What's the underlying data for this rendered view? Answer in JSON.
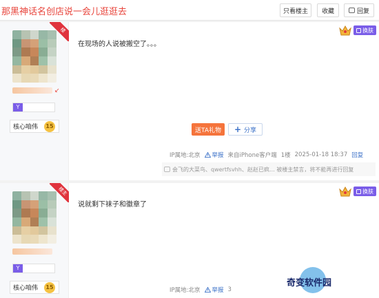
{
  "header": {
    "title": "那黑神话名创店说一会儿逛逛去",
    "only_host": "只看楼主",
    "favorite": "收藏",
    "reply": "回复"
  },
  "posts": [
    {
      "ribbon": "楼",
      "text": "在现场的人说被搬空了。。。",
      "core_label": "核心咱伟",
      "core_level": "15",
      "level_mini": "Y",
      "skin_label": "换肤",
      "gift_label": "送TA礼物",
      "share_label": "分享",
      "ip": "IP属地:北京",
      "report": "举报",
      "source": "来自iPhone客户端",
      "floor": "1楼",
      "datetime": "2025-01-18 18:37",
      "reply": "回复",
      "comments": "会飞的大菜鸟、qwertfsvhh、赵赵已疯… 被楼主禁言，将不能再进行回复"
    },
    {
      "ribbon": "楼主",
      "text": "说就剩下袜子和徽章了",
      "core_label": "核心咱伟",
      "core_level": "15",
      "level_mini": "Y",
      "skin_label": "换肤",
      "ip": "IP属地:北京",
      "report": "举报",
      "extra": "3"
    }
  ],
  "watermark": "奇变软件园"
}
